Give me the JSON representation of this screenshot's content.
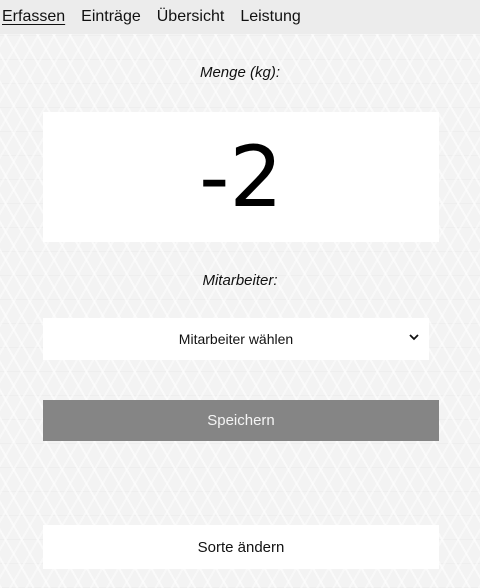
{
  "nav": {
    "items": [
      {
        "label": "Erfassen",
        "active": true
      },
      {
        "label": "Einträge",
        "active": false
      },
      {
        "label": "Übersicht",
        "active": false
      },
      {
        "label": "Leistung",
        "active": false
      }
    ]
  },
  "form": {
    "quantity_label": "Menge (kg):",
    "quantity_value": "-2",
    "employee_label": "Mitarbeiter:",
    "employee_select": {
      "selected": "Mitarbeiter wählen",
      "icon": "chevron-down-icon"
    },
    "save_label": "Speichern",
    "change_sort_label": "Sorte ändern"
  },
  "colors": {
    "save_button_bg": "#858585",
    "background": "#f3f3f3"
  }
}
